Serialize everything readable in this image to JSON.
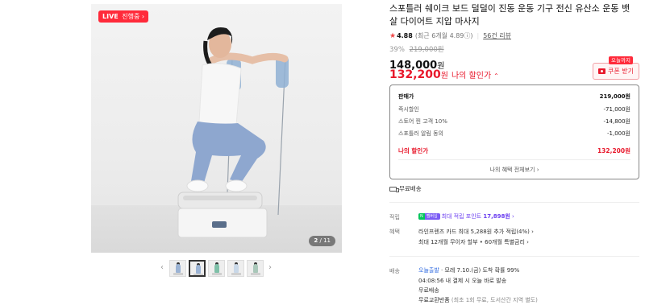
{
  "gallery": {
    "live_badge": {
      "prefix": "LIVE",
      "text": "진행중",
      "arrow": "›"
    },
    "counter": {
      "current": "2",
      "separator": "/",
      "total": "11"
    },
    "thumbnails_count": 5,
    "active_thumbnail": 2,
    "prev_arrow": "‹",
    "next_arrow": "›"
  },
  "product": {
    "title": "스포틀러 쉐이크 보드 덜덜이 진동 운동 기구 전신 유산소 운동 뱃살 다이어트 지압 마사지",
    "rating": {
      "star": "★",
      "score": "4.88",
      "recent": "(최근 6개월 4.89ⓘ)",
      "review_link": "56건 리뷰"
    },
    "discount_percent": "39%",
    "original_price": "219,000원",
    "price": "148,000",
    "price_unit": "원",
    "my_price": "132,200",
    "my_price_unit": "원",
    "my_price_label": "나의 할인가",
    "my_price_caret": "⌃",
    "today_badge": "오늘까지",
    "coupon_button": "쿠폰 받기"
  },
  "breakdown": {
    "rows": [
      {
        "label": "판매가",
        "value": "219,000원"
      },
      {
        "label": "즉시할인",
        "value": "-71,000원"
      },
      {
        "label": "스토어 찐 고객 10%",
        "value": "-14,800원"
      },
      {
        "label": "스포틀러 알림 동의",
        "value": "-1,000원"
      }
    ],
    "my_price": {
      "label": "나의 할인가",
      "value": "132,200원"
    },
    "view_all": "나의 혜택 전체보기 ›"
  },
  "shipping_summary": "무료배송",
  "benefits": {
    "points_label": "적립",
    "points_badge_n": "N",
    "points_badge_text": "멤버십",
    "points_text": "최대 적립 포인트 ",
    "points_value": "17,898원",
    "points_arrow": " ›",
    "card_label": "혜택",
    "card_line1": "라인프렌즈 카드 최대 5,288원 추가 적립(4%) ›",
    "card_line2": "최대 12개월 무이자 할부 • 60개월 특별금리 ›"
  },
  "delivery": {
    "label": "배송",
    "today_ship": "오늘출발",
    "arrival": " · 모레 7.10.(금) 도착 확률 99%",
    "cutoff": "04:08:56  내 결제 시 오늘 바로 발송",
    "free": "무료배송",
    "exchange": "무료교환반품",
    "exchange_note": " (최초 1회 무료, 도서산간 지역 별도)"
  }
}
